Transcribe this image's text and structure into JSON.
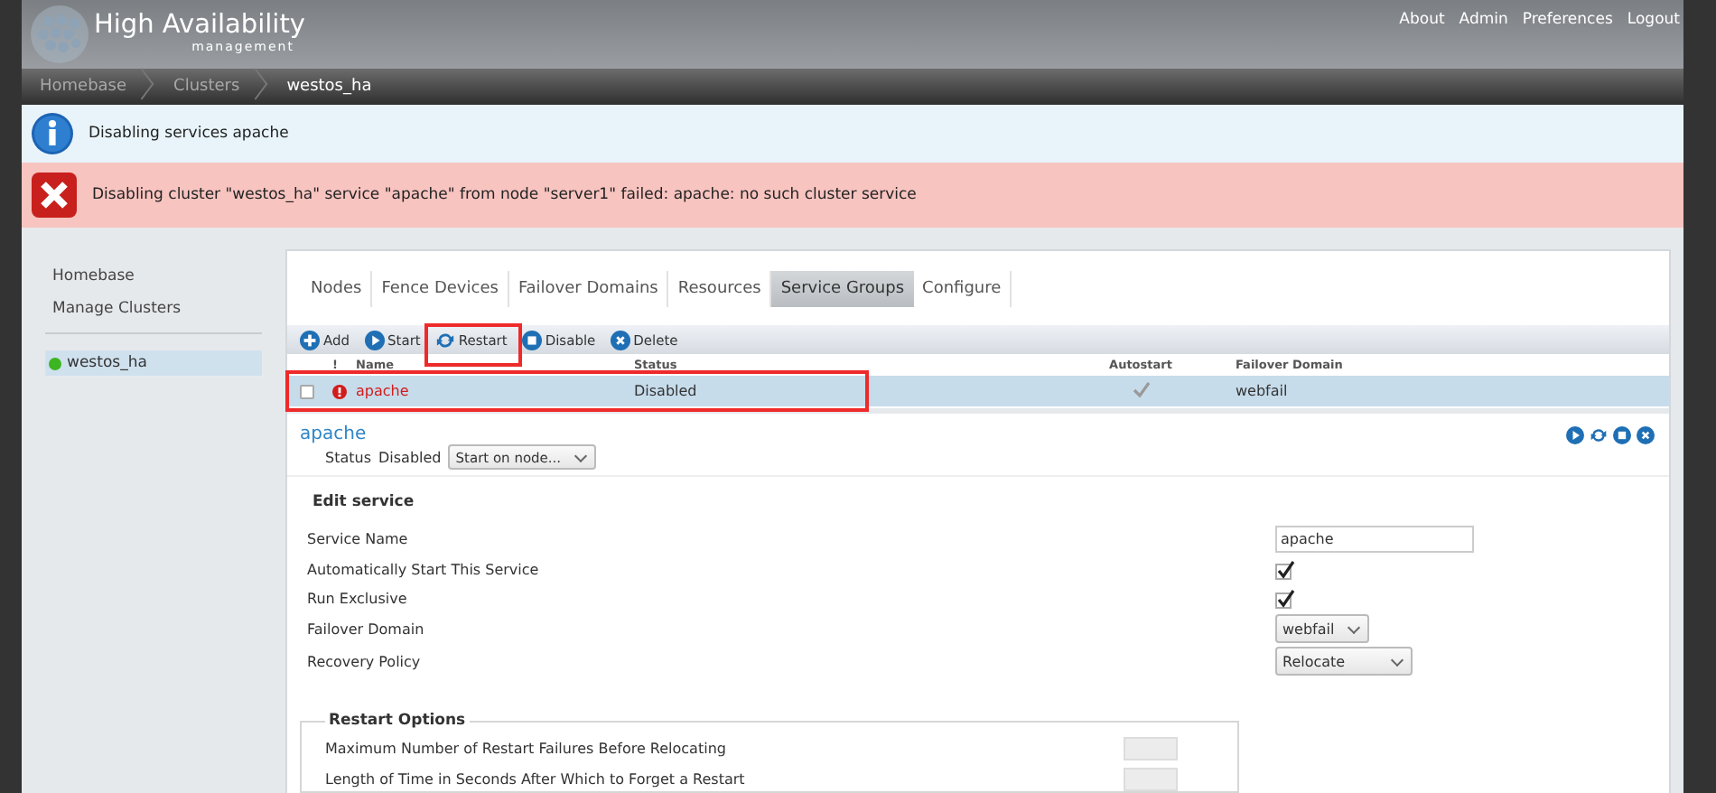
{
  "header": {
    "title": "High Availability",
    "subtitle": "management",
    "links": [
      "About",
      "Admin",
      "Preferences",
      "Logout"
    ]
  },
  "breadcrumb": [
    {
      "label": "Homebase",
      "current": false
    },
    {
      "label": "Clusters",
      "current": false
    },
    {
      "label": "westos_ha",
      "current": true
    }
  ],
  "alerts": [
    {
      "kind": "info",
      "text": "Disabling services apache"
    },
    {
      "kind": "error",
      "text": "Disabling cluster \"westos_ha\" service \"apache\" from node \"server1\" failed: apache: no such cluster service"
    }
  ],
  "sidebar": {
    "links": [
      "Homebase",
      "Manage Clusters"
    ],
    "clusters": [
      {
        "name": "westos_ha",
        "selected": true,
        "color": "#3cb521"
      }
    ]
  },
  "tabs": [
    {
      "label": "Nodes",
      "selected": false
    },
    {
      "label": "Fence Devices",
      "selected": false
    },
    {
      "label": "Failover Domains",
      "selected": false
    },
    {
      "label": "Resources",
      "selected": false
    },
    {
      "label": "Service Groups",
      "selected": true
    },
    {
      "label": "Configure",
      "selected": false
    }
  ],
  "toolbar": [
    {
      "label": "Add",
      "kind": "add",
      "highlighted": false
    },
    {
      "label": "Start",
      "kind": "start",
      "highlighted": false
    },
    {
      "label": "Restart",
      "kind": "restart",
      "highlighted": true
    },
    {
      "label": "Disable",
      "kind": "disable",
      "highlighted": false
    },
    {
      "label": "Delete",
      "kind": "delete",
      "highlighted": false
    }
  ],
  "table": {
    "columns": [
      "!",
      "Name",
      "Status",
      "Autostart",
      "Failover Domain"
    ],
    "rows": [
      {
        "checked": false,
        "error": true,
        "name": "apache",
        "status": "Disabled",
        "autostart": true,
        "failover_domain": "webfail",
        "selected": true,
        "highlighted": true
      }
    ]
  },
  "service": {
    "name": "apache",
    "status_label": "Status",
    "status": "Disabled",
    "start_select": "Start on node..."
  },
  "edit": {
    "title": "Edit service",
    "fields": [
      {
        "label": "Service Name",
        "kind": "text",
        "value": "apache"
      },
      {
        "label": "Automatically Start This Service",
        "kind": "checkbox",
        "checked": true
      },
      {
        "label": "Run Exclusive",
        "kind": "checkbox",
        "checked": true
      },
      {
        "label": "Failover Domain",
        "kind": "select",
        "value": "webfail"
      },
      {
        "label": "Recovery Policy",
        "kind": "select",
        "value": "Relocate"
      }
    ]
  },
  "restart_options": {
    "title": "Restart Options",
    "fields": [
      {
        "label": "Maximum Number of Restart Failures Before Relocating",
        "kind": "text"
      },
      {
        "label": "Length of Time in Seconds After Which to Forget a Restart",
        "kind": "text"
      }
    ]
  }
}
